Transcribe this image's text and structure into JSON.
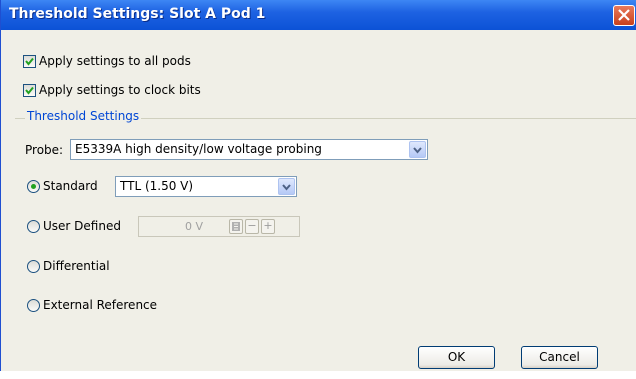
{
  "window": {
    "title": "Threshold Settings: Slot A Pod 1"
  },
  "options": {
    "apply_all_pods": {
      "label": "Apply settings to all pods",
      "checked": true
    },
    "apply_clock_bits": {
      "label": "Apply settings to clock bits",
      "checked": true
    }
  },
  "threshold_group": {
    "legend": "Threshold Settings",
    "probe_label": "Probe:",
    "probe_value": "E5339A high density/low voltage probing",
    "modes": [
      {
        "label": "Standard",
        "selected": true
      },
      {
        "label": "User Defined",
        "selected": false
      },
      {
        "label": "Differential",
        "selected": false
      },
      {
        "label": "External Reference",
        "selected": false
      }
    ],
    "standard_value": "TTL (1.50 V)",
    "user_defined_value": "0 V",
    "spin_minus": "−",
    "spin_plus": "+"
  },
  "buttons": {
    "ok": "OK",
    "cancel": "Cancel"
  },
  "colors": {
    "titlebar": "#0c52d6",
    "legend": "#0046d5",
    "radio_dot": "#21a121"
  }
}
